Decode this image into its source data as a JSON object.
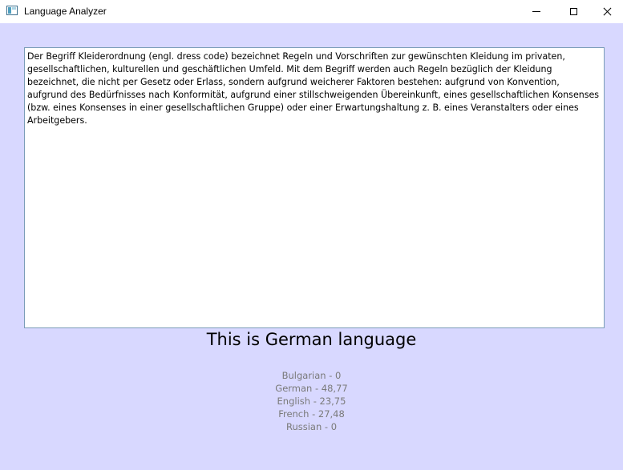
{
  "window": {
    "title": "Language Analyzer",
    "client_background": "#d8d8ff"
  },
  "input": {
    "text": "Der Begriff Kleiderordnung (engl. dress code) bezeichnet Regeln und Vorschriften zur gewünschten Kleidung im privaten, gesellschaftlichen, kulturellen und geschäftlichen Umfeld. Mit dem Begriff werden auch Regeln bezüglich der Kleidung bezeichnet, die nicht per Gesetz oder Erlass, sondern aufgrund weicherer Faktoren bestehen: aufgrund von Konvention, aufgrund des Bedürfnisses nach Konformität, aufgrund einer stillschweigenden Übereinkunft, eines gesellschaftlichen Konsenses (bzw. eines Konsenses in einer gesellschaftlichen Gruppe) oder einer Erwartungshaltung z. B. eines Veranstalters oder eines Arbeitgebers."
  },
  "result": {
    "label": "This is German language"
  },
  "scores": [
    "Bulgarian - 0",
    "German - 48,77",
    "English - 23,75",
    "French - 27,48",
    "Russian - 0"
  ]
}
